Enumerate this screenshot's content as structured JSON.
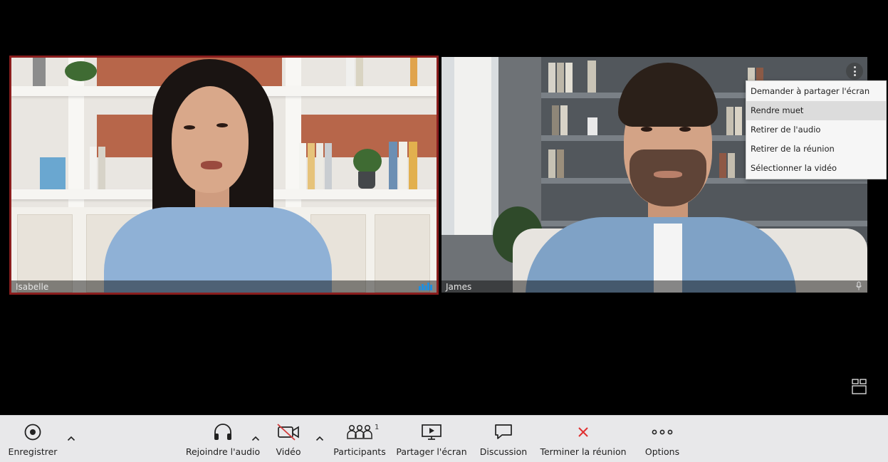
{
  "participants": [
    {
      "name": "Isabelle",
      "speaking": true
    },
    {
      "name": "James",
      "muted": true
    }
  ],
  "context_menu": {
    "items": [
      {
        "label": "Demander à partager l'écran"
      },
      {
        "label": "Rendre muet",
        "hovered": true
      },
      {
        "label": "Retirer de l'audio"
      },
      {
        "label": "Retirer de la réunion"
      },
      {
        "label": "Sélectionner la vidéo"
      }
    ]
  },
  "toolbar": {
    "record_label": "Enregistrer",
    "audio_label": "Rejoindre l'audio",
    "video_label": "Vidéo",
    "participants_label": "Participants",
    "participants_count": "1",
    "share_label": "Partager l'écran",
    "chat_label": "Discussion",
    "end_label": "Terminer la réunion",
    "options_label": "Options"
  },
  "colors": {
    "active_speaker_border": "#8a1d1d",
    "audio_level": "#1e8fe0",
    "end_meeting": "#e03030",
    "video_off": "#d23a3a",
    "toolbar_bg": "#e8e8ea"
  },
  "icons": [
    "record-icon",
    "headphones-icon",
    "video-off-icon",
    "participants-icon",
    "share-screen-icon",
    "chat-icon",
    "close-icon",
    "more-icon",
    "layout-icon",
    "microphone-icon",
    "audio-level-icon",
    "kebab-icon"
  ]
}
